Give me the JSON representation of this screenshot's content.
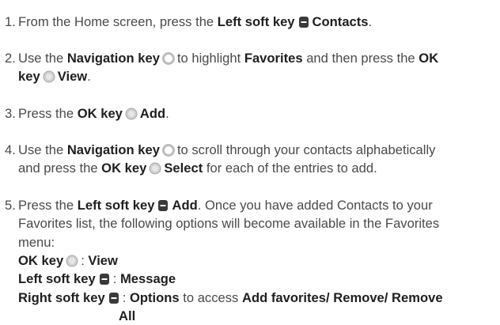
{
  "steps": [
    {
      "num": "1.",
      "parts": [
        {
          "t": "From the Home screen, press the "
        },
        {
          "t": "Left soft key",
          "b": true
        },
        {
          "icon": "softkey-icon"
        },
        {
          "t": "Contacts",
          "b": true
        },
        {
          "t": "."
        }
      ]
    },
    {
      "num": "2.",
      "lines": [
        [
          {
            "t": "Use the "
          },
          {
            "t": "Navigation key",
            "b": true
          },
          {
            "icon": "navkey-icon"
          },
          {
            "t": "to highlight "
          },
          {
            "t": "Favorites",
            "b": true
          },
          {
            "t": " and then press the "
          },
          {
            "t": "OK",
            "b": true
          }
        ],
        [
          {
            "t": "key",
            "b": true
          },
          {
            "icon": "okkey-icon"
          },
          {
            "t": "View",
            "b": true
          },
          {
            "t": "."
          }
        ]
      ]
    },
    {
      "num": "3.",
      "parts": [
        {
          "t": "Press the "
        },
        {
          "t": "OK key",
          "b": true
        },
        {
          "icon": "okkey-icon"
        },
        {
          "t": "Add",
          "b": true
        },
        {
          "t": "."
        }
      ]
    },
    {
      "num": "4.",
      "lines": [
        [
          {
            "t": "Use the "
          },
          {
            "t": "Navigation key",
            "b": true
          },
          {
            "icon": "navkey-icon"
          },
          {
            "t": "to scroll through your contacts alphabetically"
          }
        ],
        [
          {
            "t": "and press the "
          },
          {
            "t": "OK key",
            "b": true
          },
          {
            "icon": "okkey-icon"
          },
          {
            "t": "Select",
            "b": true
          },
          {
            "t": " for each of the entries to add."
          }
        ]
      ]
    },
    {
      "num": "5.",
      "lines": [
        [
          {
            "t": "Press the "
          },
          {
            "t": "Left soft key",
            "b": true
          },
          {
            "icon": "softkey-icon"
          },
          {
            "t": "Add",
            "b": true
          },
          {
            "t": ". Once you have added Contacts to your"
          }
        ],
        [
          {
            "t": "Favorites list, the following options will become available in the Favorites"
          }
        ],
        [
          {
            "t": "menu:"
          }
        ],
        [
          {
            "t": "OK key",
            "b": true
          },
          {
            "icon": "okkey-icon"
          },
          {
            "t": ": "
          },
          {
            "t": "View",
            "b": true
          }
        ],
        [
          {
            "t": "Left soft key",
            "b": true
          },
          {
            "icon": "softkey-icon"
          },
          {
            "t": ": "
          },
          {
            "t": "Message",
            "b": true
          }
        ],
        [
          {
            "t": "Right soft key",
            "b": true
          },
          {
            "icon": "softkey-icon"
          },
          {
            "t": ": "
          },
          {
            "t": "Options",
            "b": true
          },
          {
            "t": " to access "
          },
          {
            "t": "Add favorites/ Remove/ Remove",
            "b": true
          }
        ],
        [
          {
            "t": "All",
            "b": true,
            "indent": true
          }
        ]
      ]
    }
  ],
  "colors": {
    "text": "#4a4a4a",
    "bold": "#1f1f1f",
    "softkey": "#3a3a3a",
    "nav": "#bdbdbd"
  }
}
